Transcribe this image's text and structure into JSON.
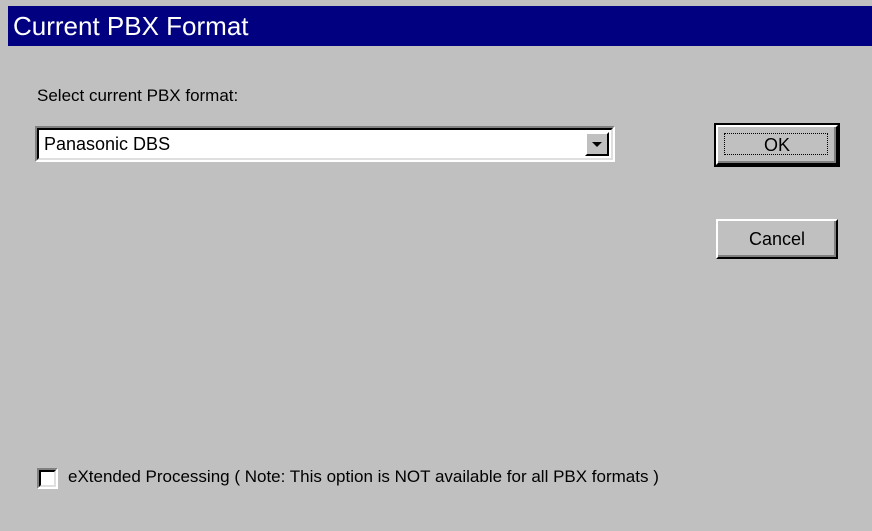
{
  "window": {
    "title": "Current PBX Format"
  },
  "form": {
    "select_label": "Select current PBX format:",
    "pbx_format": {
      "selected_value": "Panasonic DBS"
    },
    "extended_processing": {
      "label": "eXtended Processing ( Note: This option is NOT available for all PBX formats )",
      "checked": false
    }
  },
  "buttons": {
    "ok_label": "OK",
    "cancel_label": "Cancel"
  },
  "icons": {
    "dropdown": "chevron-down-icon"
  },
  "colors": {
    "titlebar": "#000080",
    "titlebar_text": "#ffffff",
    "dialog_background": "#c0c0c0",
    "field_background": "#ffffff"
  }
}
